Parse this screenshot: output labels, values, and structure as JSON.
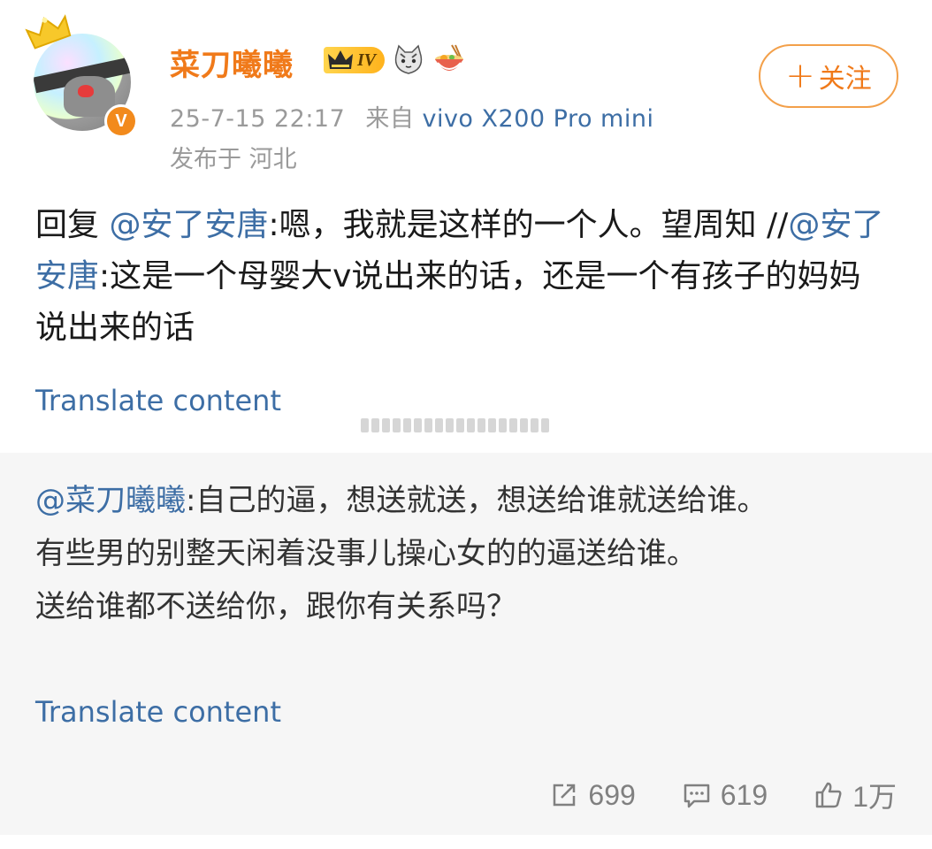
{
  "user": {
    "name": "菜刀曦曦",
    "level_badge": "IV",
    "timestamp": "25-7-15 22:17",
    "source_prefix": "来自",
    "device": "vivo X200 Pro mini",
    "location": "发布于 河北",
    "verified_mark": "V"
  },
  "follow_button": {
    "plus": "+",
    "label": "关注"
  },
  "post": {
    "reply_prefix": "回复 ",
    "mention1": "@安了安唐",
    "text1": ":嗯，我就是这样的一个人。望周知 //",
    "mention2": "@安了安唐",
    "text2": ":这是一个母婴大v说出来的话，还是一个有孩子的妈妈说出来的话",
    "translate": "Translate content"
  },
  "quoted": {
    "mention": "@菜刀曦曦",
    "text1": ":自己的逼，想送就送，想送给谁就送给谁。",
    "text2": "有些男的别整天闲着没事儿操心女的的逼送给谁。",
    "text3": "送给谁都不送给你，跟你有关系吗？",
    "translate": "Translate content"
  },
  "stats": {
    "reposts": "699",
    "comments": "619",
    "likes": "1万"
  },
  "colors": {
    "username": "#f07a1a",
    "link": "#3d6ea5",
    "meta": "#9a9a9a",
    "quoted_bg": "#f6f6f6"
  }
}
